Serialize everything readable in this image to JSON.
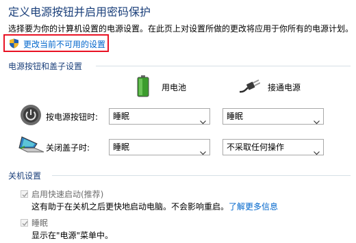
{
  "page": {
    "title": "定义电源按钮并启用密码保护",
    "description": "选择要为你的计算机设置的电源设置。在此页上对设置所做的更改将应用于你所有的电源计划。",
    "change_link": "更改当前不可用的设置",
    "highlight_color": "#e81123"
  },
  "power_buttons": {
    "section_title": "电源按钮和盖子设置",
    "columns": {
      "battery": "用电池",
      "plugged_in": "接通电源"
    },
    "rows": [
      {
        "label": "按电源按钮时:",
        "battery": "睡眠",
        "plugged_in": "睡眠"
      },
      {
        "label": "关闭盖子时:",
        "battery": "睡眠",
        "plugged_in": "不采取任何操作"
      }
    ]
  },
  "shutdown": {
    "section_title": "关机设置",
    "options": [
      {
        "label": "启用快速启动(推荐)",
        "checked": true,
        "disabled": true,
        "description": "这有助于在关机之后更快地启动电脑。不会影响重启。",
        "link": "了解更多信息"
      },
      {
        "label": "睡眠",
        "checked": true,
        "disabled": true,
        "description": "显示在\"电源\"菜单中。"
      }
    ]
  },
  "icons": [
    "shield-icon",
    "battery-icon",
    "power-plug-icon",
    "power-button-icon",
    "laptop-lid-icon",
    "chevron-down-icon",
    "checkmark-icon"
  ]
}
